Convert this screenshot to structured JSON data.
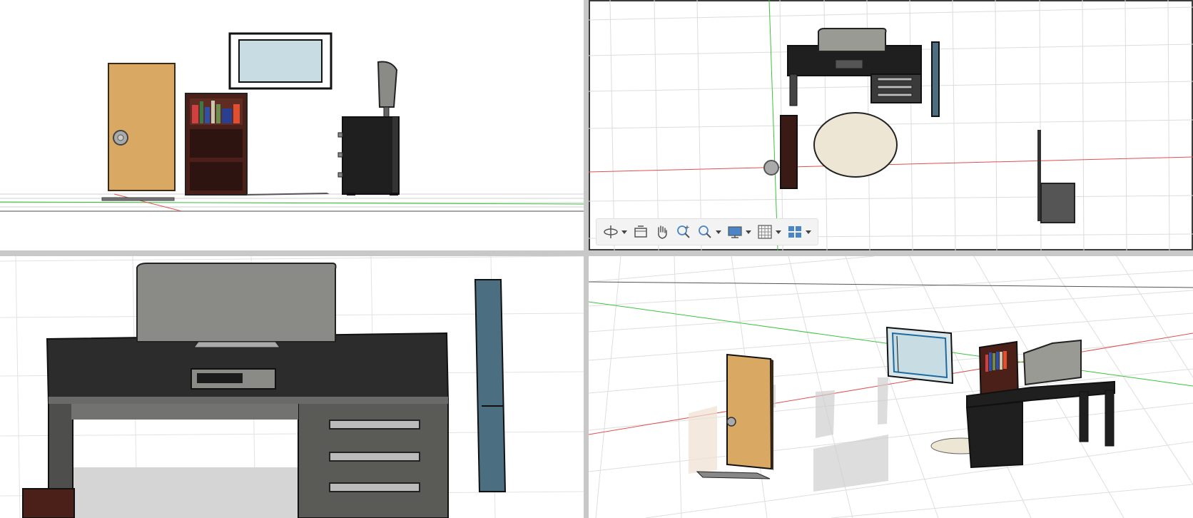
{
  "viewports": {
    "front": {
      "view": "front"
    },
    "top": {
      "view": "top"
    },
    "closeup": {
      "view": "top-zoom"
    },
    "perspective": {
      "view": "perspective"
    }
  },
  "navigation_bar": {
    "items": [
      {
        "icon": "orbit-icon",
        "dropdown": true
      },
      {
        "icon": "look-at-icon",
        "dropdown": false
      },
      {
        "icon": "pan-hand-icon",
        "dropdown": false
      },
      {
        "icon": "zoom-icon",
        "dropdown": false
      },
      {
        "icon": "fit-zoom-icon",
        "dropdown": true
      },
      {
        "icon": "display-settings-icon",
        "dropdown": true
      },
      {
        "icon": "grid-snap-icon",
        "dropdown": true
      },
      {
        "icon": "viewports-icon",
        "dropdown": true
      }
    ]
  },
  "colors": {
    "door": "#d9a862",
    "bookshelf": "#4a2019",
    "desk": "#1f1f1f",
    "monitor": "#8a8a86",
    "window_glass": "#c8dde3",
    "rug": "#ede6d4",
    "x_axis": "#e05050",
    "y_axis": "#3cc43c",
    "grid": "#d8d8d8"
  }
}
